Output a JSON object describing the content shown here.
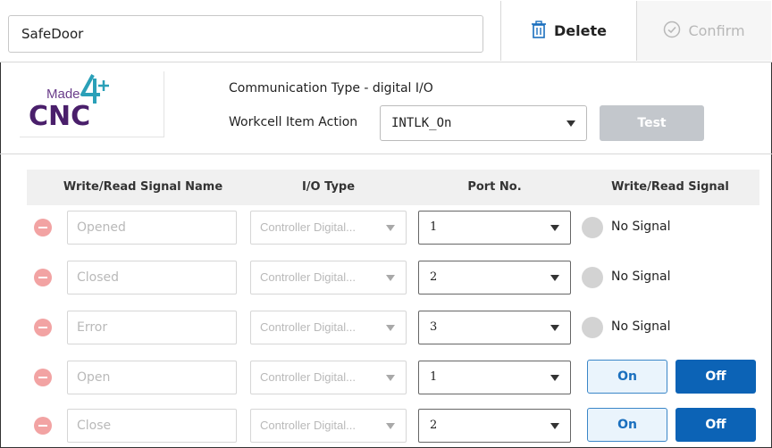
{
  "header": {
    "item_name": "SafeDoor",
    "delete_label": "Delete",
    "confirm_label": "Confirm"
  },
  "logo": {
    "text": "Made 4 CNC",
    "icon": "made4cnc-logo"
  },
  "info": {
    "communication_type": "Communication Type - digital I/O",
    "action_label": "Workcell Item Action",
    "action_value": "INTLK_On",
    "test_label": "Test"
  },
  "table": {
    "headers": [
      "Write/Read Signal Name",
      "I/O Type",
      "Port No.",
      "Write/Read Signal"
    ],
    "rows": [
      {
        "name": "Opened",
        "io_type": "Controller Digital...",
        "port": "1",
        "signal": "No Signal",
        "kind": "read"
      },
      {
        "name": "Closed",
        "io_type": "Controller Digital...",
        "port": "2",
        "signal": "No Signal",
        "kind": "read"
      },
      {
        "name": "Error",
        "io_type": "Controller Digital...",
        "port": "3",
        "signal": "No Signal",
        "kind": "read"
      },
      {
        "name": "Open",
        "io_type": "Controller Digital...",
        "port": "1",
        "on_label": "On",
        "off_label": "Off",
        "kind": "write"
      },
      {
        "name": "Close",
        "io_type": "Controller Digital...",
        "port": "2",
        "on_label": "On",
        "off_label": "Off",
        "kind": "write"
      }
    ]
  },
  "colors": {
    "accent": "#0c63b6",
    "on_border": "#3a86c8",
    "remove": "#f2a3a3",
    "test_disabled": "#c3c7cc",
    "logo_purple": "#4a1f6b",
    "logo_teal": "#2aa0b8"
  }
}
